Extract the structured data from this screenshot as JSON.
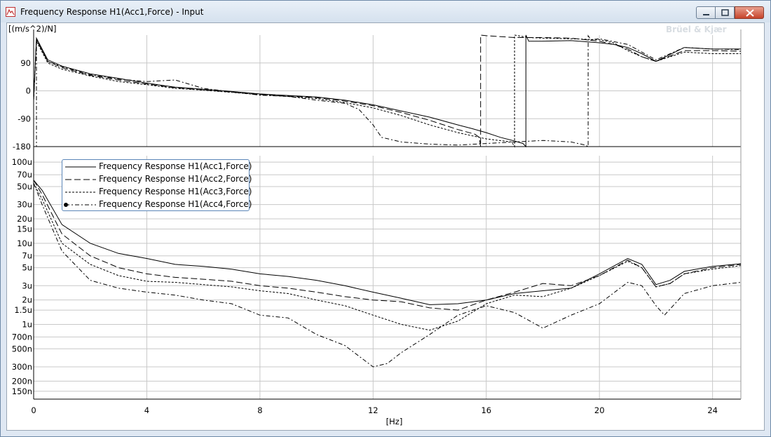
{
  "window": {
    "title": "Frequency Response H1(Acc1,Force) - Input",
    "brand": "Brüel & Kjær"
  },
  "icons": [
    "app-icon",
    "minimize-icon",
    "maximize-icon",
    "close-icon",
    "bruel-kjaer-logo"
  ],
  "chart_data": [
    {
      "type": "line",
      "title": "",
      "ylabel": "[(m/s^2)/N]",
      "xlabel": "",
      "xlim": [
        0,
        25
      ],
      "ylim": [
        -180,
        180
      ],
      "yticks": [
        90,
        0,
        -90,
        -180
      ],
      "grid": true,
      "series": [
        {
          "name": "Frequency Response H1(Acc1,Force)",
          "x": [
            0,
            0.1,
            0.5,
            1,
            2,
            3,
            4,
            5,
            6,
            7,
            8,
            9,
            10,
            11,
            12,
            13,
            14,
            15,
            15.5,
            16,
            16.5,
            17,
            17.3,
            17.4,
            17.5,
            18,
            19,
            20,
            20.5,
            21,
            21.5,
            22,
            23,
            24,
            25
          ],
          "y": [
            -30,
            170,
            100,
            80,
            55,
            40,
            25,
            12,
            5,
            -2,
            -10,
            -15,
            -20,
            -30,
            -45,
            -65,
            -85,
            -110,
            -122,
            -135,
            -150,
            -162,
            -170,
            180,
            160,
            160,
            162,
            155,
            150,
            140,
            120,
            95,
            140,
            135,
            135
          ]
        },
        {
          "name": "Frequency Response H1(Acc2,Force)",
          "x": [
            0,
            0.1,
            0.5,
            1,
            2,
            3,
            4,
            5,
            6,
            7,
            8,
            9,
            10,
            11,
            12,
            13,
            14,
            15,
            15.6,
            15.75,
            15.8,
            16,
            17,
            18,
            19,
            20,
            20.5,
            21,
            21.5,
            22,
            23,
            24,
            25
          ],
          "y": [
            -30,
            165,
            95,
            75,
            50,
            35,
            22,
            10,
            3,
            -4,
            -12,
            -17,
            -22,
            -33,
            -48,
            -70,
            -95,
            -125,
            -140,
            -150,
            180,
            178,
            172,
            172,
            170,
            160,
            150,
            135,
            110,
            95,
            130,
            130,
            128
          ]
        },
        {
          "name": "Frequency Response H1(Acc3,Force)",
          "x": [
            0,
            0.1,
            0.5,
            1,
            2,
            3,
            4,
            5,
            6,
            7,
            8,
            9,
            10,
            11,
            12,
            13,
            14,
            15,
            16,
            16.9,
            17.0,
            17.5,
            18,
            19,
            20,
            20.5,
            21,
            21.5,
            22,
            23,
            24,
            25
          ],
          "y": [
            -30,
            160,
            90,
            70,
            48,
            30,
            20,
            8,
            2,
            -5,
            -13,
            -18,
            -25,
            -38,
            -55,
            -80,
            -110,
            -135,
            -155,
            -165,
            180,
            172,
            170,
            168,
            165,
            155,
            130,
            110,
            95,
            125,
            120,
            120
          ]
        },
        {
          "name": "Frequency Response H1(Acc4,Force)",
          "x": [
            0,
            0.1,
            0.5,
            1,
            2,
            3,
            4,
            5,
            6,
            7,
            8,
            9,
            10,
            11,
            11.5,
            12,
            12.3,
            13,
            14,
            15,
            16,
            17,
            18,
            19,
            19.5,
            19.6,
            19.7,
            20,
            21,
            22,
            23,
            24,
            25
          ],
          "y": [
            -180,
            165,
            95,
            78,
            52,
            38,
            30,
            35,
            8,
            -3,
            -14,
            -18,
            -30,
            -40,
            -60,
            -110,
            -150,
            -165,
            -172,
            -175,
            -170,
            -165,
            -160,
            -165,
            -175,
            178,
            165,
            168,
            150,
            100,
            140,
            135,
            133
          ]
        }
      ]
    },
    {
      "type": "line",
      "title": "",
      "xlabel": "[Hz]",
      "ylabel": "",
      "xlim": [
        0,
        25
      ],
      "ylim": [
        0.00012,
        0.0001
      ],
      "y_scale": "log",
      "xticks": [
        0,
        4,
        8,
        12,
        16,
        20,
        24
      ],
      "ytick_labels": [
        "100u",
        "70u",
        "50u",
        "30u",
        "20u",
        "15u",
        "10u",
        "7u",
        "5u",
        "3u",
        "2u",
        "1.5u",
        "1u",
        "700n",
        "500n",
        "300n",
        "200n",
        "150n"
      ],
      "grid": true,
      "legend": "top-left",
      "series": [
        {
          "name": "Frequency Response H1(Acc1,Force)",
          "x": [
            0,
            0.3,
            1,
            2,
            3,
            4,
            5,
            6,
            7,
            8,
            9,
            10,
            11,
            12,
            13,
            14,
            15,
            16,
            17,
            18,
            19,
            20,
            21,
            21.5,
            22,
            22.5,
            23,
            24,
            25
          ],
          "y": [
            6e-05,
            4.5e-05,
            1.7e-05,
            1e-05,
            7.5e-06,
            6.5e-06,
            5.5e-06,
            5.2e-06,
            4.8e-06,
            4.2e-06,
            3.9e-06,
            3.5e-06,
            3e-06,
            2.5e-06,
            2.1e-06,
            1.75e-06,
            1.8e-06,
            2e-06,
            2.4e-06,
            2.6e-06,
            2.8e-06,
            4.2e-06,
            6.5e-06,
            5.5e-06,
            3.1e-06,
            3.5e-06,
            4.5e-06,
            5.2e-06,
            5.6e-06
          ]
        },
        {
          "name": "Frequency Response H1(Acc2,Force)",
          "x": [
            0,
            0.3,
            1,
            2,
            3,
            4,
            5,
            6,
            7,
            8,
            9,
            10,
            11,
            12,
            13,
            14,
            15,
            16,
            17,
            18,
            19,
            20,
            21,
            21.5,
            22,
            22.5,
            23,
            24,
            25
          ],
          "y": [
            6e-05,
            4e-05,
            1.3e-05,
            7e-06,
            5e-06,
            4.2e-06,
            3.8e-06,
            3.6e-06,
            3.4e-06,
            3e-06,
            2.8e-06,
            2.5e-06,
            2.2e-06,
            2e-06,
            1.9e-06,
            1.6e-06,
            1.5e-06,
            2e-06,
            2.5e-06,
            3.2e-06,
            3e-06,
            4e-06,
            6.2e-06,
            5e-06,
            2.9e-06,
            3.2e-06,
            4.2e-06,
            5e-06,
            5.5e-06
          ]
        },
        {
          "name": "Frequency Response H1(Acc3,Force)",
          "x": [
            0,
            0.3,
            1,
            2,
            3,
            4,
            5,
            6,
            7,
            8,
            9,
            10,
            11,
            12,
            13,
            14,
            15,
            16,
            17,
            18,
            19,
            20,
            21,
            21.5,
            22,
            22.5,
            23,
            24,
            25
          ],
          "y": [
            5.5e-05,
            3.5e-05,
            1e-05,
            5.5e-06,
            4e-06,
            3.4e-06,
            3.3e-06,
            3.1e-06,
            2.9e-06,
            2.6e-06,
            2.4e-06,
            2e-06,
            1.7e-06,
            1.3e-06,
            1e-06,
            8.5e-07,
            1.1e-06,
            1.8e-06,
            2.3e-06,
            2.2e-06,
            2.8e-06,
            4e-06,
            6e-06,
            5e-06,
            2.9e-06,
            3.2e-06,
            4.2e-06,
            4.8e-06,
            5.3e-06
          ]
        },
        {
          "name": "Frequency Response H1(Acc4,Force)",
          "x": [
            0,
            0.3,
            1,
            2,
            3,
            4,
            5,
            6,
            7,
            8,
            9,
            10,
            11,
            12,
            12.5,
            13,
            14,
            15,
            16,
            17,
            18,
            19,
            20,
            21,
            21.5,
            22,
            22.3,
            23,
            24,
            25
          ],
          "y": [
            5.5e-05,
            3e-05,
            8e-06,
            3.5e-06,
            2.8e-06,
            2.5e-06,
            2.3e-06,
            2e-06,
            1.8e-06,
            1.3e-06,
            1.2e-06,
            7.5e-07,
            5.5e-07,
            3e-07,
            3.3e-07,
            4.5e-07,
            7.5e-07,
            1.3e-06,
            1.7e-06,
            1.4e-06,
            9e-07,
            1.3e-06,
            1.8e-06,
            3.3e-06,
            3e-06,
            1.7e-06,
            1.3e-06,
            2.4e-06,
            3e-06,
            3.3e-06
          ]
        }
      ]
    }
  ]
}
